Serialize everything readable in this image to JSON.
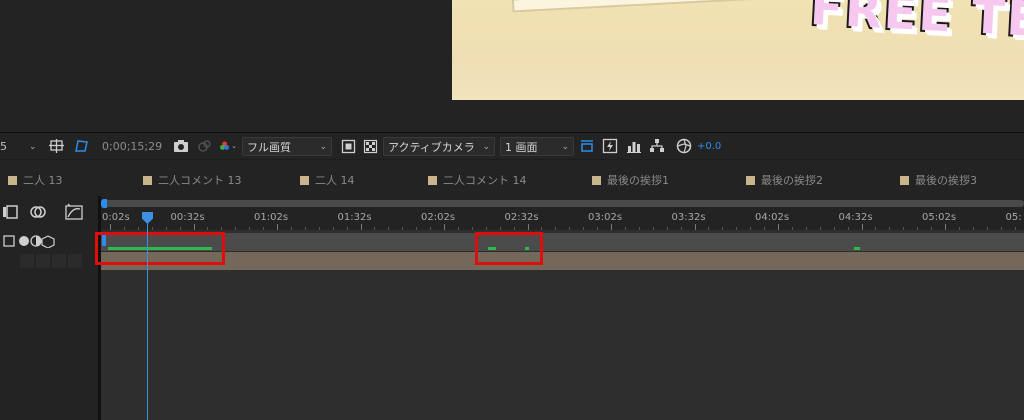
{
  "toolbar": {
    "zoom_fragment": "5",
    "timecode": "0;00;15;29",
    "resolution": "フル画質",
    "view": "アクティブカメラ",
    "layout": "1 画面",
    "exposure": "+0.0",
    "accent_color": "#2d8ceb"
  },
  "viewer": {
    "overlay_text": "FREE TE"
  },
  "layer_labels": [
    {
      "name": "二人 13",
      "swatch": "#c9b48c"
    },
    {
      "name": "二人コメント 13",
      "swatch": "#c9b48c"
    },
    {
      "name": "二人 14",
      "swatch": "#c9b48c"
    },
    {
      "name": "二人コメント 14",
      "swatch": "#c9b48c"
    },
    {
      "name": "最後の挨拶1",
      "swatch": "#c9b48c"
    },
    {
      "name": "最後の挨拶2",
      "swatch": "#c9b48c"
    },
    {
      "name": "最後の挨拶3",
      "swatch": "#c9b48c"
    }
  ],
  "timeline": {
    "ruler_labels": [
      "0:02s",
      "00:32s",
      "01:02s",
      "01:32s",
      "02:02s",
      "02:32s",
      "03:02s",
      "03:32s",
      "04:02s",
      "04:32s",
      "05:02s",
      "05:"
    ],
    "highlight_color": "#e00d0d",
    "keyframe_color": "#2fb94a"
  }
}
